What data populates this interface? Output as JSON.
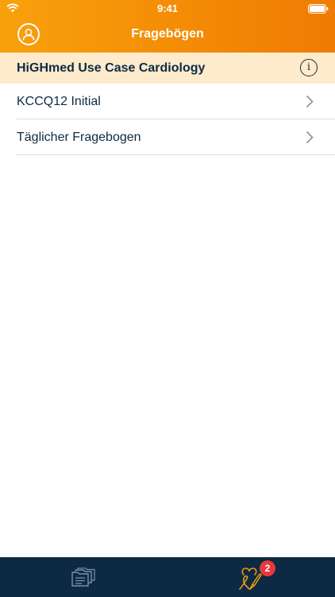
{
  "status_bar": {
    "time": "9:41"
  },
  "nav": {
    "title": "Fragebögen",
    "left_icon": "user-icon"
  },
  "section": {
    "title": "HiGHmed Use Case Cardiology",
    "info_icon": "info-icon"
  },
  "questionnaires": [
    {
      "label": "KCCQ12 Initial"
    },
    {
      "label": "Täglicher Fragebogen"
    }
  ],
  "tab_bar": {
    "tabs": [
      {
        "icon": "folder-documents-icon"
      },
      {
        "icon": "questionnaire-heart-icon",
        "badge": "2"
      }
    ]
  },
  "colors": {
    "header_start": "#f8a10c",
    "header_end": "#ef7b03",
    "section_bg": "#fdebcc",
    "tab_bar_bg": "#0c2a44",
    "badge": "#e8383d",
    "text_dark": "#0e2a42",
    "icon_orange": "#f39a0b"
  }
}
